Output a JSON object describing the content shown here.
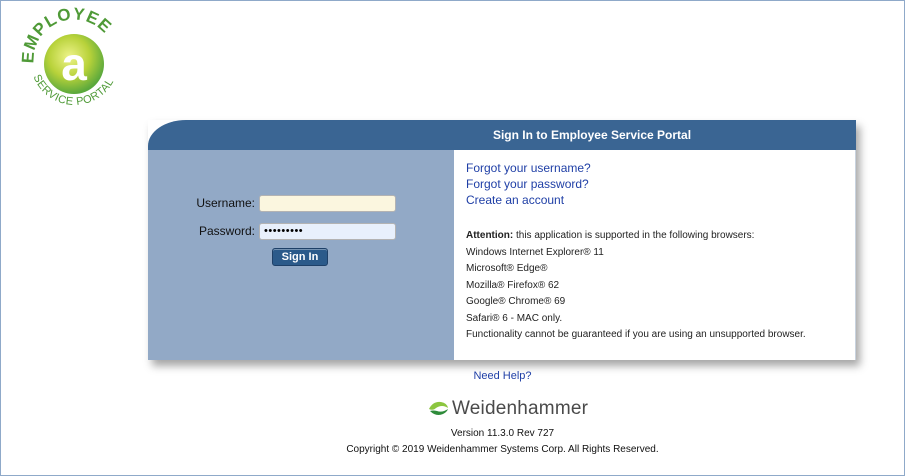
{
  "logo": {
    "arc_text": "EMPLOYEE",
    "bottom_text": "SERVICE PORTAL",
    "letter": "a",
    "colors": {
      "green": "#5aa83c",
      "lime": "#c5d93a"
    }
  },
  "panel": {
    "title": "Sign In to Employee Service Portal",
    "form": {
      "username_label": "Username:",
      "username_value": "",
      "password_label": "Password:",
      "password_value": "•••••••••",
      "signin_label": "Sign In"
    },
    "links": {
      "forgot_username": "Forgot your username?",
      "forgot_password": "Forgot your password?",
      "create_account": "Create an account"
    },
    "attention": {
      "label": "Attention:",
      "text": " this application is supported in the following browsers:",
      "browsers": [
        "Windows Internet Explorer® 11",
        "Microsoft® Edge®",
        "Mozilla® Firefox® 62",
        "Google® Chrome® 69",
        "Safari® 6 - MAC only."
      ],
      "disclaimer": "Functionality cannot be guaranteed if you are using an unsupported browser."
    }
  },
  "footer": {
    "need_help": "Need Help?",
    "brand": "Weidenhammer",
    "version": "Version 11.3.0 Rev 727",
    "copyright": "Copyright © 2019 Weidenhammer Systems Corp. All Rights Reserved."
  },
  "colors": {
    "header_blue": "#3a6593",
    "left_panel": "#92a9c6",
    "link_blue": "#1f3fa6",
    "button_blue": "#2b5a8a"
  }
}
